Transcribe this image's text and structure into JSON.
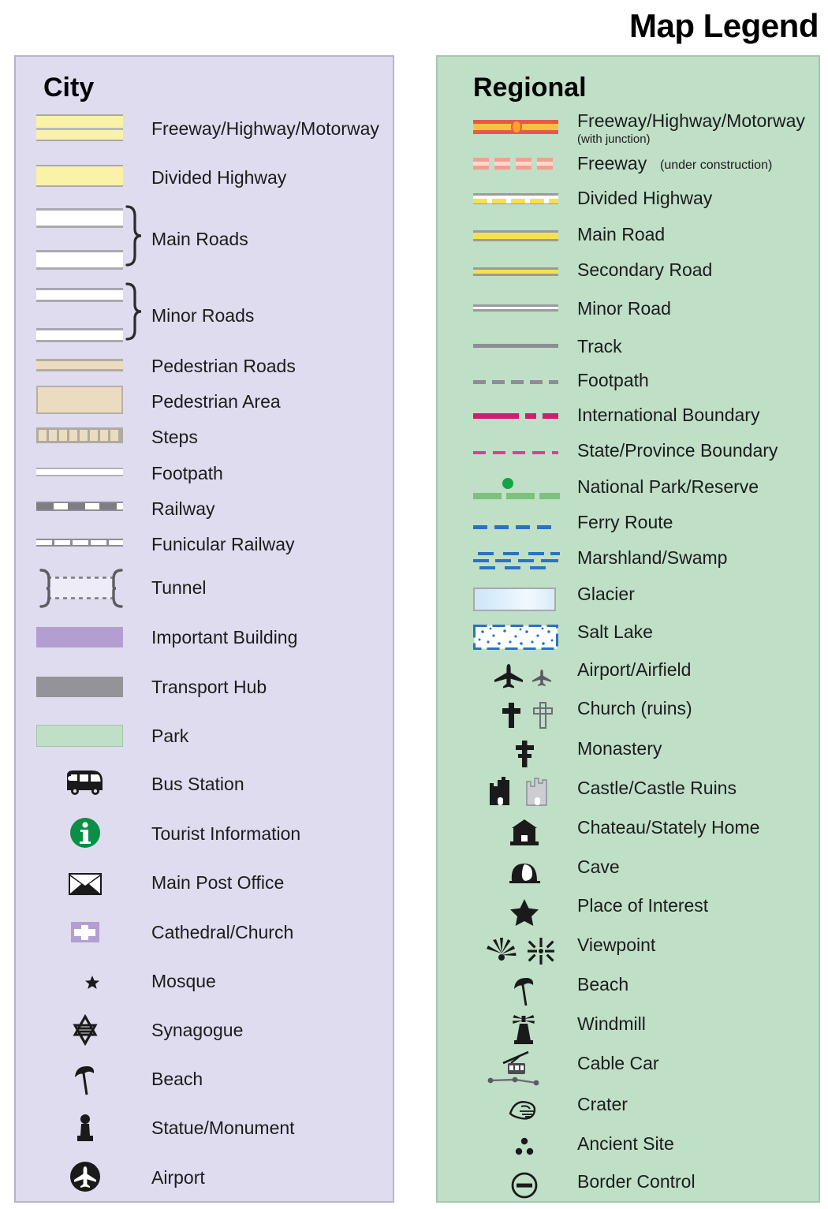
{
  "title": "Map Legend",
  "city": {
    "heading": "City",
    "items": [
      {
        "label": "Freeway/Highway/Motorway",
        "icon": "freeway-swatch"
      },
      {
        "label": "Divided Highway",
        "icon": "divided-highway-swatch"
      },
      {
        "label": "Main Roads",
        "icon": "main-roads-swatch"
      },
      {
        "label": "Minor Roads",
        "icon": "minor-roads-swatch"
      },
      {
        "label": "Pedestrian Roads",
        "icon": "pedestrian-road-swatch"
      },
      {
        "label": "Pedestrian Area",
        "icon": "pedestrian-area-swatch"
      },
      {
        "label": "Steps",
        "icon": "steps-swatch"
      },
      {
        "label": "Footpath",
        "icon": "footpath-swatch"
      },
      {
        "label": "Railway",
        "icon": "railway-swatch"
      },
      {
        "label": "Funicular Railway",
        "icon": "funicular-railway-swatch"
      },
      {
        "label": "Tunnel",
        "icon": "tunnel-swatch"
      },
      {
        "label": "Important Building",
        "icon": "important-building-swatch"
      },
      {
        "label": "Transport Hub",
        "icon": "transport-hub-swatch"
      },
      {
        "label": "Park",
        "icon": "park-swatch"
      },
      {
        "label": "Bus Station",
        "icon": "bus-icon"
      },
      {
        "label": "Tourist Information",
        "icon": "information-icon"
      },
      {
        "label": "Main Post Office",
        "icon": "envelope-icon"
      },
      {
        "label": "Cathedral/Church",
        "icon": "church-cross-icon"
      },
      {
        "label": "Mosque",
        "icon": "crescent-star-icon"
      },
      {
        "label": "Synagogue",
        "icon": "star-of-david-icon"
      },
      {
        "label": "Beach",
        "icon": "beach-umbrella-icon"
      },
      {
        "label": "Statue/Monument",
        "icon": "statue-icon"
      },
      {
        "label": "Airport",
        "icon": "airport-circle-icon"
      }
    ]
  },
  "regional": {
    "heading": "Regional",
    "items": [
      {
        "label": "Freeway/Highway/Motorway",
        "sublabel": "(with junction)",
        "icon": "freeway-junction-line"
      },
      {
        "label": "Freeway",
        "inline_sub": "(under construction)",
        "icon": "freeway-construction-line"
      },
      {
        "label": "Divided Highway",
        "icon": "divided-highway-line"
      },
      {
        "label": "Main Road",
        "icon": "main-road-line"
      },
      {
        "label": "Secondary Road",
        "icon": "secondary-road-line"
      },
      {
        "label": "Minor Road",
        "icon": "minor-road-line"
      },
      {
        "label": "Track",
        "icon": "track-line"
      },
      {
        "label": "Footpath",
        "icon": "footpath-line"
      },
      {
        "label": "International Boundary",
        "icon": "international-boundary-line"
      },
      {
        "label": "State/Province Boundary",
        "icon": "state-boundary-line"
      },
      {
        "label": "National Park/Reserve",
        "icon": "national-park-line"
      },
      {
        "label": "Ferry Route",
        "icon": "ferry-route-line"
      },
      {
        "label": "Marshland/Swamp",
        "icon": "marshland-pattern"
      },
      {
        "label": "Glacier",
        "icon": "glacier-swatch"
      },
      {
        "label": "Salt Lake",
        "icon": "salt-lake-pattern"
      },
      {
        "label": "Airport/Airfield",
        "icon": "airplane-icon"
      },
      {
        "label": "Church (ruins)",
        "icon": "cross-icon"
      },
      {
        "label": "Monastery",
        "icon": "monastery-cross-icon"
      },
      {
        "label": "Castle/Castle Ruins",
        "icon": "castle-icon"
      },
      {
        "label": "Chateau/Stately Home",
        "icon": "chateau-icon"
      },
      {
        "label": "Cave",
        "icon": "cave-icon"
      },
      {
        "label": "Place of Interest",
        "icon": "star-icon"
      },
      {
        "label": "Viewpoint",
        "icon": "viewpoint-icon"
      },
      {
        "label": "Beach",
        "icon": "beach-umbrella-icon"
      },
      {
        "label": "Windmill",
        "icon": "windmill-icon"
      },
      {
        "label": "Cable Car",
        "icon": "cable-car-icon"
      },
      {
        "label": "Crater",
        "icon": "crater-icon"
      },
      {
        "label": "Ancient Site",
        "icon": "ancient-site-icon"
      },
      {
        "label": "Border Control",
        "icon": "border-control-icon"
      }
    ]
  },
  "colors": {
    "city_panel_bg": "#dedcee",
    "regional_panel_bg": "#bfdfc6",
    "highway_yellow": "#f9f2a8",
    "road_yellow": "#f7e14a",
    "freeway_red": "#e8584a",
    "junction_orange": "#f5a623",
    "pedestrian_beige": "#ebdcc0",
    "important_building_purple": "#b39ed2",
    "transport_hub_gray": "#939399",
    "park_green": "#bfdfc6",
    "info_green": "#0a8f44",
    "boundary_magenta": "#cf1e72",
    "state_boundary_pink": "#e03f8c",
    "national_park_green": "#7ec17c",
    "ferry_blue": "#2a72c4",
    "glacier_blue": "#cfe6f7"
  }
}
